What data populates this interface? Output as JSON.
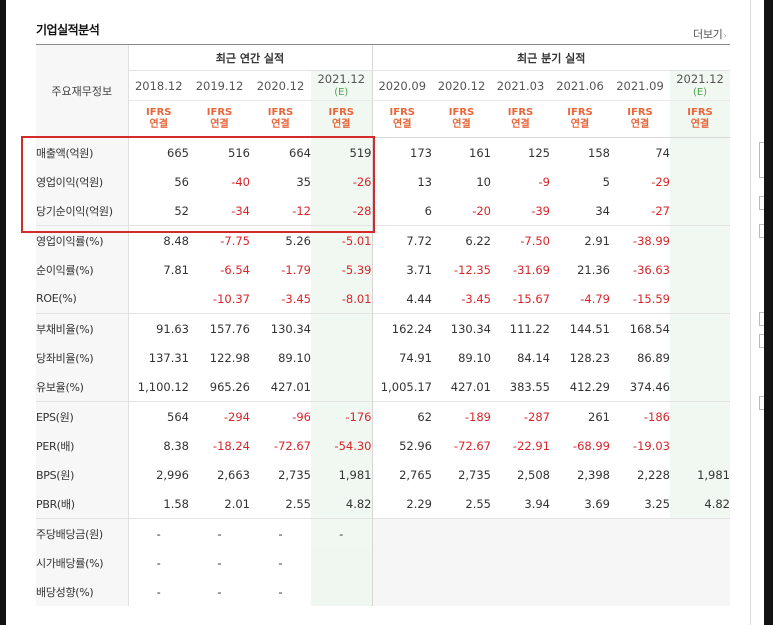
{
  "section_title": "기업실적분석",
  "more_label": "더보기",
  "more_arrow": "›",
  "header": {
    "item_label": "주요재무정보",
    "annual_label": "최근 연간 실적",
    "quarter_label": "최근 분기 실적",
    "annual_periods": [
      {
        "period": "2018.12",
        "note": ""
      },
      {
        "period": "2019.12",
        "note": ""
      },
      {
        "period": "2020.12",
        "note": ""
      },
      {
        "period": "2021.12",
        "note": "(E)"
      }
    ],
    "quarter_periods": [
      {
        "period": "2020.09",
        "note": ""
      },
      {
        "period": "2020.12",
        "note": ""
      },
      {
        "period": "2021.03",
        "note": ""
      },
      {
        "period": "2021.06",
        "note": ""
      },
      {
        "period": "2021.09",
        "note": ""
      },
      {
        "period": "2021.12",
        "note": "(E)"
      }
    ],
    "basis_line1": "IFRS",
    "basis_line2": "연결"
  },
  "rows": [
    {
      "label": "매출액(억원)",
      "annual": [
        "665",
        "516",
        "664",
        "519"
      ],
      "quarter": [
        "173",
        "161",
        "125",
        "158",
        "74",
        ""
      ]
    },
    {
      "label": "영업이익(억원)",
      "annual": [
        "56",
        "-40",
        "35",
        "-26"
      ],
      "quarter": [
        "13",
        "10",
        "-9",
        "5",
        "-29",
        ""
      ]
    },
    {
      "label": "당기순이익(억원)",
      "annual": [
        "52",
        "-34",
        "-12",
        "-28"
      ],
      "quarter": [
        "6",
        "-20",
        "-39",
        "34",
        "-27",
        ""
      ]
    },
    {
      "label": "영업이익률(%)",
      "annual": [
        "8.48",
        "-7.75",
        "5.26",
        "-5.01"
      ],
      "quarter": [
        "7.72",
        "6.22",
        "-7.50",
        "2.91",
        "-38.99",
        ""
      ]
    },
    {
      "label": "순이익률(%)",
      "annual": [
        "7.81",
        "-6.54",
        "-1.79",
        "-5.39"
      ],
      "quarter": [
        "3.71",
        "-12.35",
        "-31.69",
        "21.36",
        "-36.63",
        ""
      ]
    },
    {
      "label": "ROE(%)",
      "annual": [
        "",
        "-10.37",
        "-3.45",
        "-8.01"
      ],
      "quarter": [
        "4.44",
        "-3.45",
        "-15.67",
        "-4.79",
        "-15.59",
        ""
      ]
    },
    {
      "label": "부채비율(%)",
      "annual": [
        "91.63",
        "157.76",
        "130.34",
        ""
      ],
      "quarter": [
        "162.24",
        "130.34",
        "111.22",
        "144.51",
        "168.54",
        ""
      ]
    },
    {
      "label": "당좌비율(%)",
      "annual": [
        "137.31",
        "122.98",
        "89.10",
        ""
      ],
      "quarter": [
        "74.91",
        "89.10",
        "84.14",
        "128.23",
        "86.89",
        ""
      ]
    },
    {
      "label": "유보율(%)",
      "annual": [
        "1,100.12",
        "965.26",
        "427.01",
        ""
      ],
      "quarter": [
        "1,005.17",
        "427.01",
        "383.55",
        "412.29",
        "374.46",
        ""
      ]
    },
    {
      "label": "EPS(원)",
      "annual": [
        "564",
        "-294",
        "-96",
        "-176"
      ],
      "quarter": [
        "62",
        "-189",
        "-287",
        "261",
        "-186",
        ""
      ]
    },
    {
      "label": "PER(배)",
      "annual": [
        "8.38",
        "-18.24",
        "-72.67",
        "-54.30"
      ],
      "quarter": [
        "52.96",
        "-72.67",
        "-22.91",
        "-68.99",
        "-19.03",
        ""
      ]
    },
    {
      "label": "BPS(원)",
      "annual": [
        "2,996",
        "2,663",
        "2,735",
        "1,981"
      ],
      "quarter": [
        "2,765",
        "2,735",
        "2,508",
        "2,398",
        "2,228",
        "1,981"
      ]
    },
    {
      "label": "PBR(배)",
      "annual": [
        "1.58",
        "2.01",
        "2.55",
        "4.82"
      ],
      "quarter": [
        "2.29",
        "2.55",
        "3.94",
        "3.69",
        "3.25",
        "4.82"
      ]
    },
    {
      "label": "주당배당금(원)",
      "annual": [
        "-",
        "-",
        "-",
        "-"
      ],
      "quarter": [
        "",
        "",
        "",
        "",
        "",
        ""
      ]
    },
    {
      "label": "시가배당률(%)",
      "annual": [
        "-",
        "-",
        "-",
        ""
      ],
      "quarter": [
        "",
        "",
        "",
        "",
        "",
        ""
      ]
    },
    {
      "label": "배당성향(%)",
      "annual": [
        "-",
        "-",
        "-",
        ""
      ],
      "quarter": [
        "",
        "",
        "",
        "",
        "",
        ""
      ]
    }
  ],
  "colors": {
    "negative": "#d6262a",
    "basis": "#e8663a",
    "estimate_bg": "#f1f8f1",
    "highlight_box": "#d42a2a"
  }
}
